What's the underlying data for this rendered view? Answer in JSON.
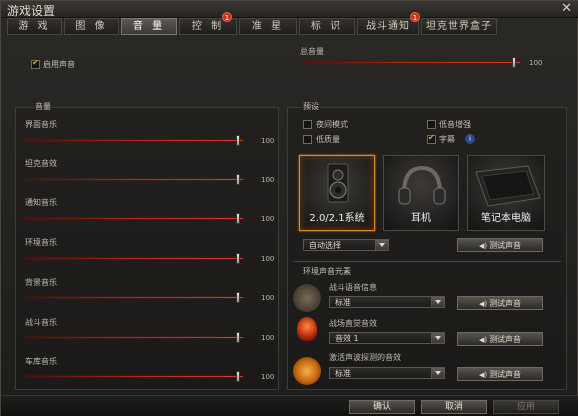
{
  "window": {
    "title": "游戏设置"
  },
  "tabs": [
    {
      "label": "游 戏",
      "active": false,
      "badge": ""
    },
    {
      "label": "图 像",
      "active": false,
      "badge": ""
    },
    {
      "label": "音 量",
      "active": true,
      "badge": ""
    },
    {
      "label": "控 制",
      "active": false,
      "badge": "1"
    },
    {
      "label": "准 星",
      "active": false,
      "badge": ""
    },
    {
      "label": "标 识",
      "active": false,
      "badge": ""
    },
    {
      "label": "战斗通知",
      "active": false,
      "badge": "1"
    },
    {
      "label": "坦克世界盒子",
      "active": false,
      "badge": ""
    }
  ],
  "enable_sound": {
    "label": "启用声音",
    "checked": true
  },
  "master": {
    "label": "总音量",
    "value": 100
  },
  "volume": {
    "title": "音量",
    "sliders": [
      {
        "label": "界面音乐",
        "value": 100
      },
      {
        "label": "坦克音效",
        "value": 100
      },
      {
        "label": "通知音乐",
        "value": 100
      },
      {
        "label": "环境音乐",
        "value": 100
      },
      {
        "label": "背景音乐",
        "value": 100
      },
      {
        "label": "战斗音乐",
        "value": 100
      },
      {
        "label": "车库音乐",
        "value": 100
      }
    ]
  },
  "presets": {
    "title": "预设",
    "options": [
      {
        "label": "夜间模式",
        "checked": false
      },
      {
        "label": "低音增强",
        "checked": false
      },
      {
        "label": "低质量",
        "checked": false
      },
      {
        "label": "字幕",
        "checked": true
      }
    ],
    "info_icon": "info-icon",
    "devices": [
      {
        "label": "2.0/2.1系统",
        "icon": "speaker-icon",
        "selected": true
      },
      {
        "label": "耳机",
        "icon": "headphones-icon",
        "selected": false
      },
      {
        "label": "笔记本电脑",
        "icon": "laptop-icon",
        "selected": false
      }
    ],
    "auto_select": "自动选择",
    "test_sound": "测试声音"
  },
  "env": {
    "title": "环境声音元素",
    "items": [
      {
        "label": "战斗语音信息",
        "value": "标准",
        "icon": "crew-icon"
      },
      {
        "label": "战场直觉音效",
        "value": "音效 1",
        "icon": "lightbulb-icon"
      },
      {
        "label": "激活声波探测的音效",
        "value": "标准",
        "icon": "radar-icon"
      }
    ],
    "test_sound": "测试声音"
  },
  "footer": {
    "ok": "确认",
    "cancel": "取消",
    "apply": "应用"
  }
}
